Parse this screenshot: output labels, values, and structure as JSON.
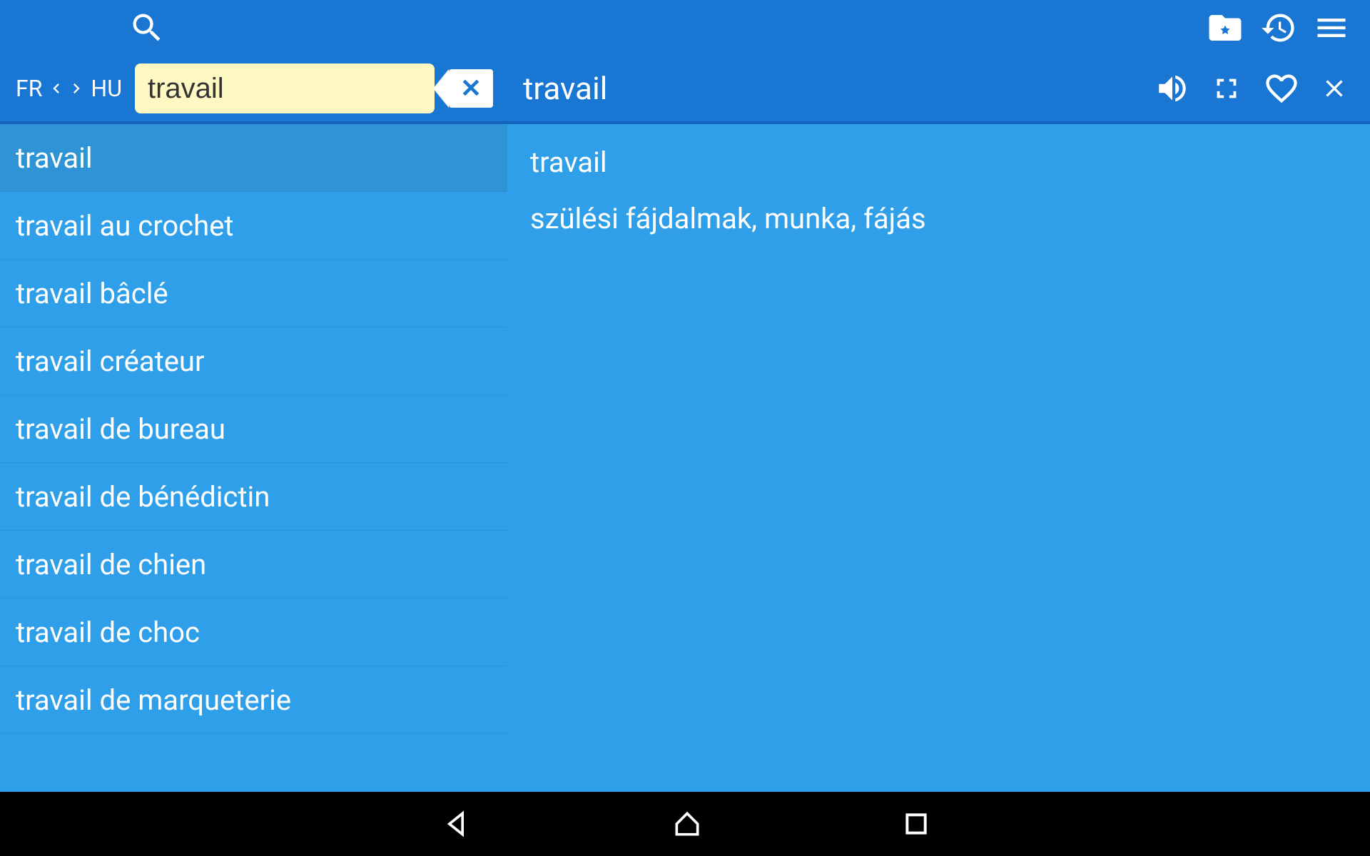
{
  "languages": {
    "source": "FR",
    "target": "HU"
  },
  "search": {
    "value": "travail"
  },
  "detail": {
    "word": "travail",
    "headword": "travail",
    "translation": "szülési fájdalmak, munka, fájás"
  },
  "results": [
    {
      "label": "travail",
      "selected": true
    },
    {
      "label": "travail au crochet",
      "selected": false
    },
    {
      "label": "travail bâclé",
      "selected": false
    },
    {
      "label": "travail créateur",
      "selected": false
    },
    {
      "label": "travail de bureau",
      "selected": false
    },
    {
      "label": "travail de bénédictin",
      "selected": false
    },
    {
      "label": "travail de chien",
      "selected": false
    },
    {
      "label": "travail de choc",
      "selected": false
    },
    {
      "label": "travail de marqueterie",
      "selected": false
    }
  ]
}
